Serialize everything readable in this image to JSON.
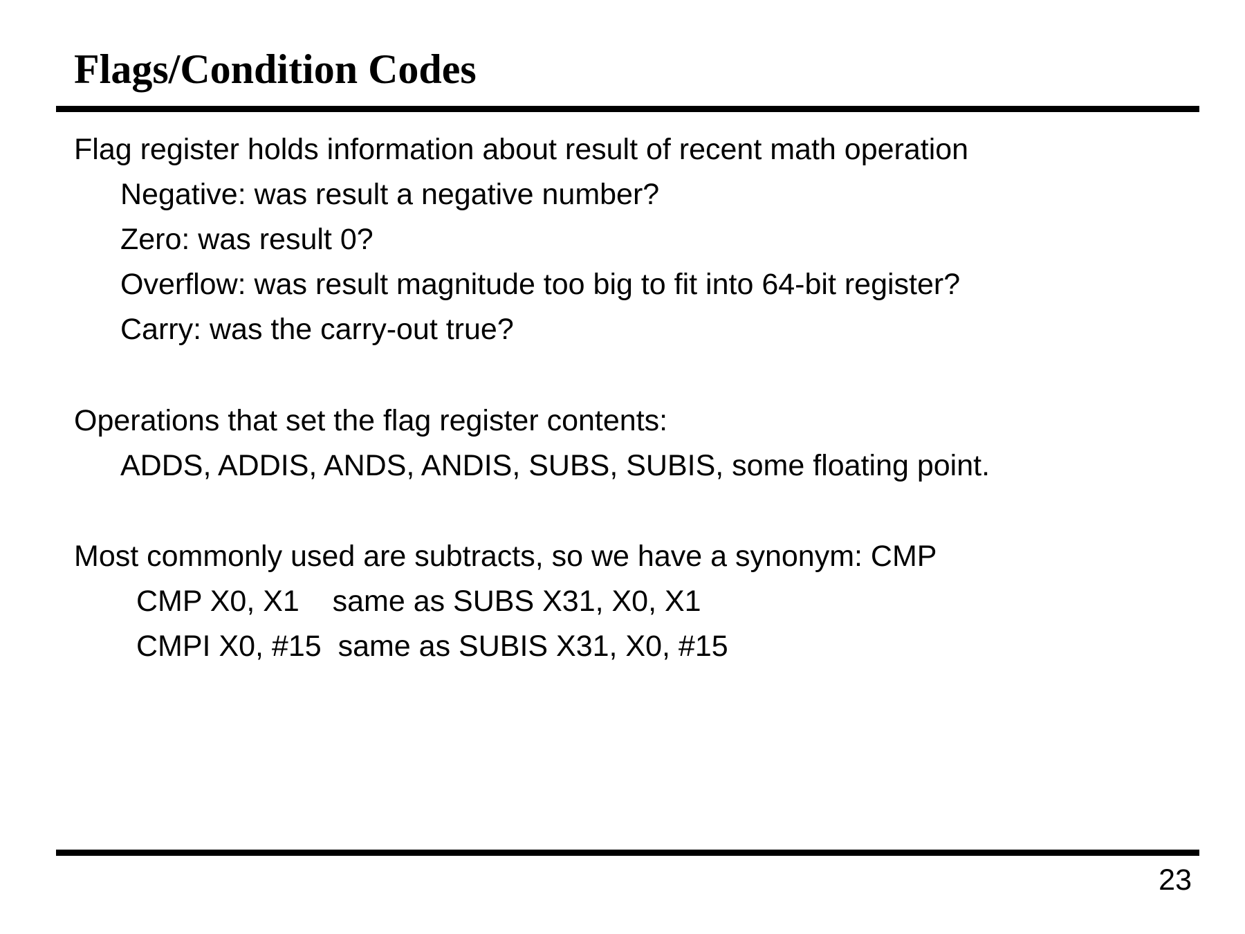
{
  "title": "Flags/Condition Codes",
  "flags_section": {
    "intro": "Flag register holds information about result of recent math operation",
    "items": [
      "Negative: was result a negative number?",
      "Zero: was result 0?",
      "Overflow: was result magnitude too big to fit into 64-bit register?",
      "Carry: was the carry-out true?"
    ]
  },
  "operations_section": {
    "intro": "Operations that set the flag register contents:",
    "items": [
      "ADDS, ADDIS, ANDS, ANDIS, SUBS, SUBIS, some floating point."
    ]
  },
  "cmp_section": {
    "intro": "Most commonly used are subtracts, so we have a synonym: CMP",
    "examples": [
      "CMP X0, X1    same as SUBS X31, X0, X1",
      "CMPI X0, #15  same as SUBIS X31, X0, #15"
    ]
  },
  "page_number": "23"
}
